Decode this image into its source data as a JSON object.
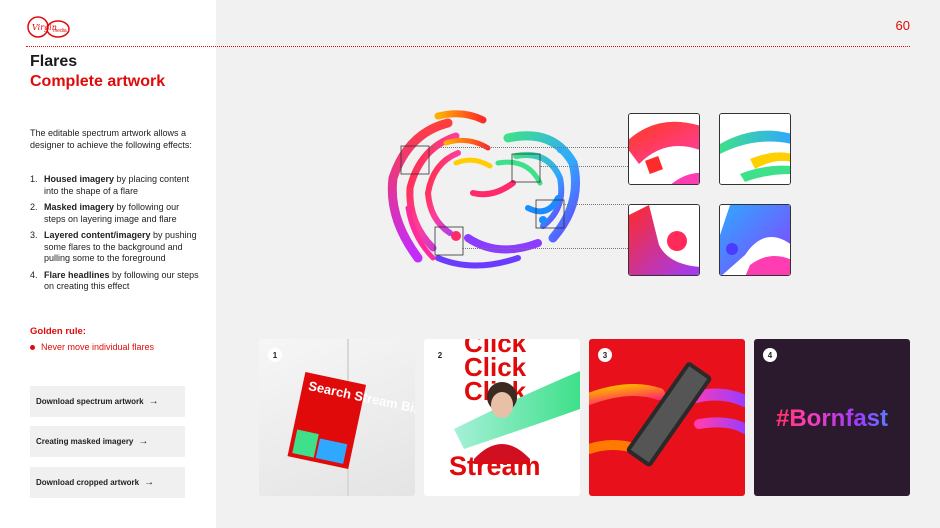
{
  "brand": {
    "logo_alt": "Virgin Media",
    "accent": "#e10a0a"
  },
  "page": {
    "number": "60"
  },
  "header": {
    "title": "Flares",
    "subtitle": "Complete artwork"
  },
  "intro": "The editable spectrum artwork allows a designer to achieve the following effects:",
  "effects": [
    {
      "num": "1.",
      "bold": "Housed imagery",
      "rest": " by placing content into the shape of a flare"
    },
    {
      "num": "2.",
      "bold": "Masked imagery",
      "rest": " by following our steps on layering image and flare"
    },
    {
      "num": "3.",
      "bold": "Layered content/imagery",
      "rest": " by pushing some flares to the background and pulling some to the foreground"
    },
    {
      "num": "4.",
      "bold": "Flare headlines",
      "rest": " by following our steps on creating this effect"
    }
  ],
  "golden_rule": {
    "title": "Golden rule:",
    "item": "Never move individual flares"
  },
  "buttons": [
    {
      "label": "Download spectrum artwork",
      "arrow": "→"
    },
    {
      "label": "Creating masked imagery",
      "arrow": "→"
    },
    {
      "label": "Download cropped artwork",
      "arrow": "→"
    }
  ],
  "examples": [
    {
      "num": "1",
      "text": "Search Stream Binge"
    },
    {
      "num": "2",
      "text_top": "Click",
      "text_bottom": "Stream"
    },
    {
      "num": "3"
    },
    {
      "num": "4",
      "text": "#Bornfast"
    }
  ]
}
